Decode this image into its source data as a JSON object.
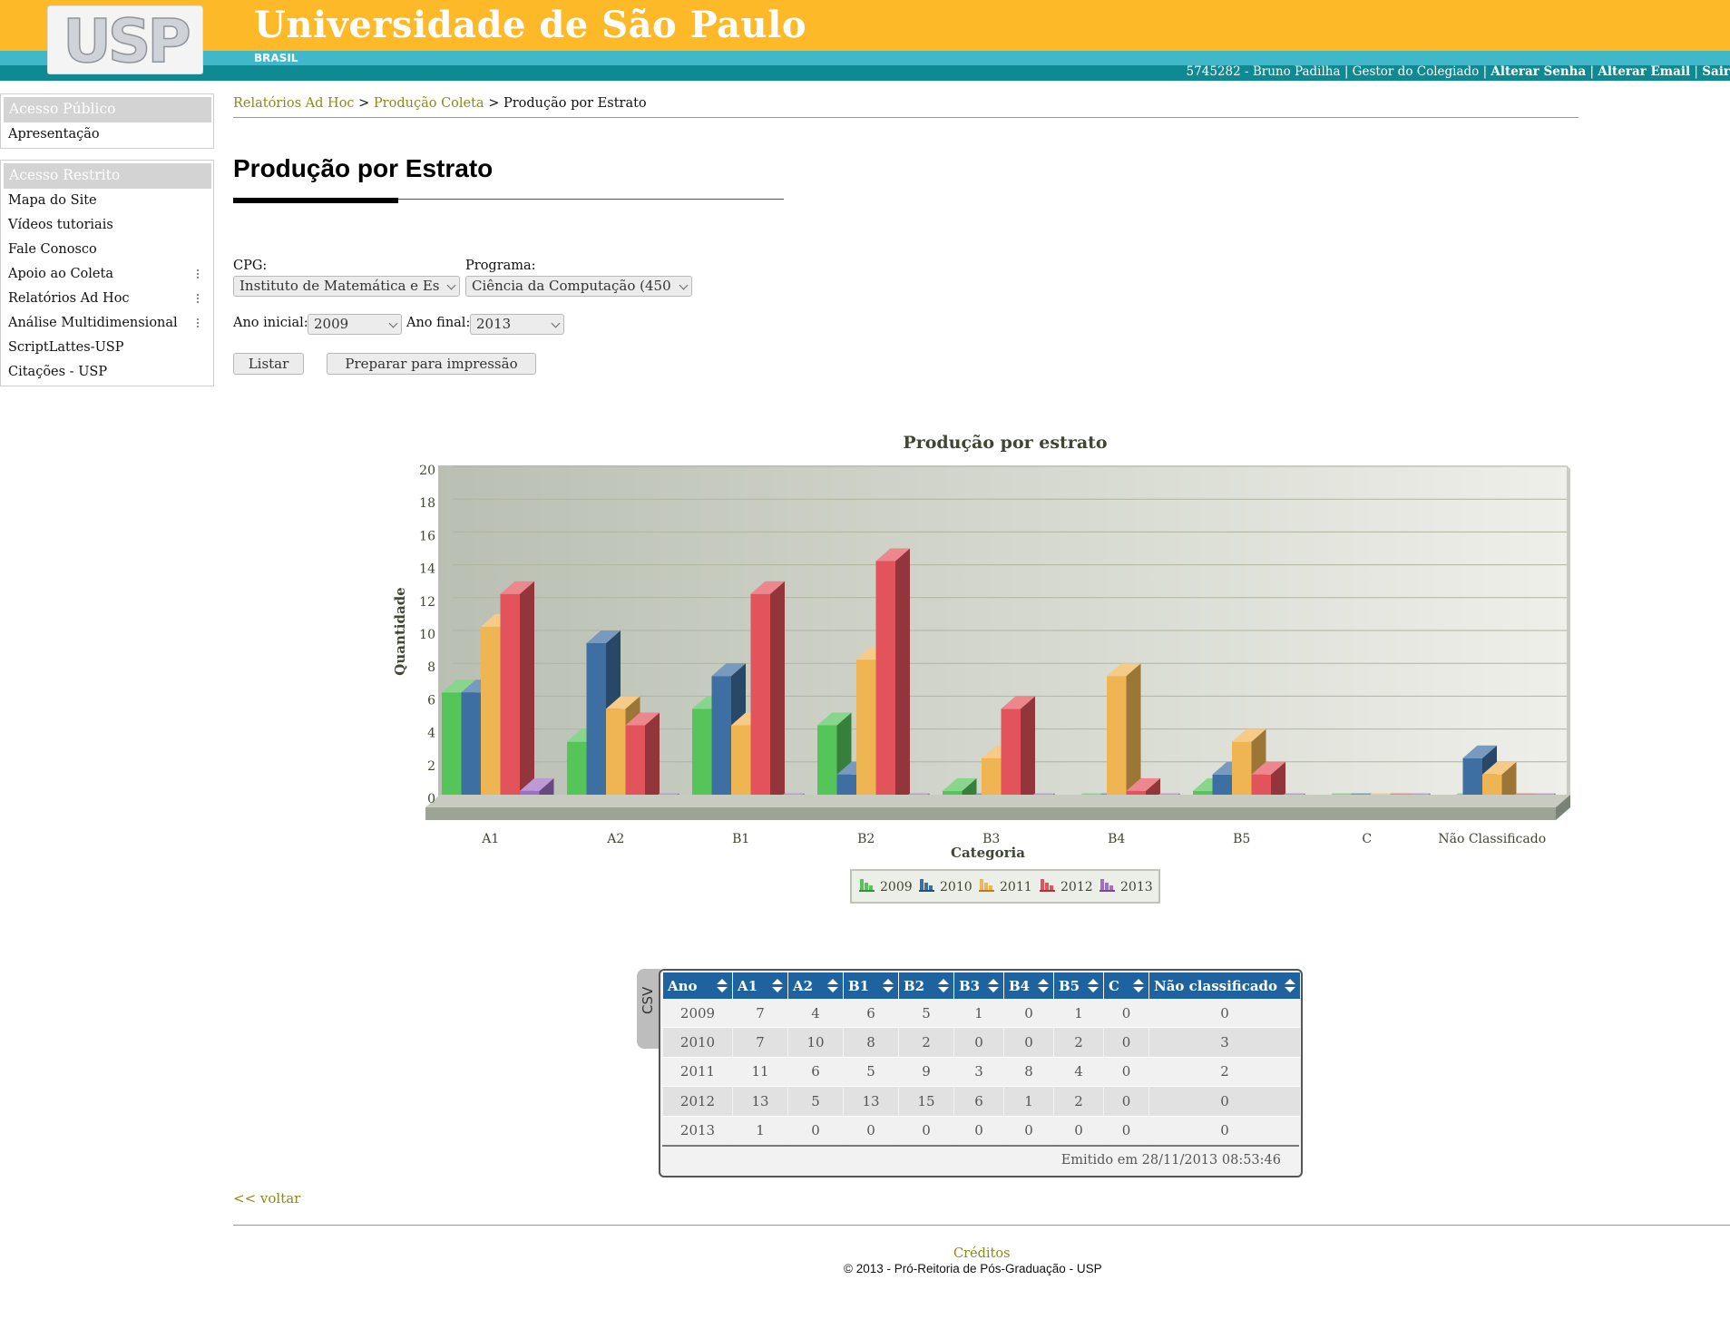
{
  "header": {
    "logo_text": "USP",
    "title": "Universidade de São Paulo",
    "country": "BRASIL",
    "user_info": "5745282 - Bruno Padilha | Gestor do Colegiado |",
    "change_password": "Alterar Senha",
    "change_email": "Alterar Email",
    "logout": "Sair",
    "sep": "|",
    "colors": {
      "top": "#fdb927",
      "stripe": "#41b8c9",
      "bar": "#0f8a93"
    }
  },
  "sidebar": {
    "public": {
      "title": "Acesso Público",
      "items": [
        "Apresentação"
      ]
    },
    "restricted": {
      "title": "Acesso Restrito",
      "items": [
        {
          "label": "Mapa do Site",
          "submenu": false
        },
        {
          "label": "Vídeos tutoriais",
          "submenu": false
        },
        {
          "label": "Fale Conosco",
          "submenu": false
        },
        {
          "label": "Apoio ao Coleta",
          "submenu": true
        },
        {
          "label": "Relatórios Ad Hoc",
          "submenu": true
        },
        {
          "label": "Análise Multidimensional",
          "submenu": true
        },
        {
          "label": "ScriptLattes-USP",
          "submenu": false
        },
        {
          "label": "Citações - USP",
          "submenu": false
        }
      ]
    }
  },
  "breadcrumb": {
    "items": [
      "Relatórios Ad Hoc",
      "Produção Coleta"
    ],
    "current": "Produção por Estrato",
    "sep": ">"
  },
  "page": {
    "title": "Produção por Estrato"
  },
  "form": {
    "cpg_label": "CPG:",
    "cpg_value": "Instituto de Matemática e Es",
    "program_label": "Programa:",
    "program_value": "Ciência da Computação (450",
    "start_label": "Ano inicial:",
    "start_value": "2009",
    "end_label": "Ano final:",
    "end_value": "2013",
    "list_button": "Listar",
    "print_button": "Preparar para impressão"
  },
  "chart_data": {
    "type": "bar",
    "title": "Produção por estrato",
    "xlabel": "Categoria",
    "ylabel": "Quantidade",
    "ylim": [
      0,
      20
    ],
    "yticks": [
      0,
      2,
      4,
      6,
      8,
      10,
      12,
      14,
      16,
      18,
      20
    ],
    "grid": true,
    "legend_position": "bottom",
    "categories": [
      "A1",
      "A2",
      "B1",
      "B2",
      "B3",
      "B4",
      "B5",
      "C",
      "Não Classificado"
    ],
    "series": [
      {
        "name": "2009",
        "color": "#55c55a",
        "values": [
          7,
          4,
          6,
          5,
          1,
          0,
          1,
          0,
          0
        ]
      },
      {
        "name": "2010",
        "color": "#3d6fa2",
        "values": [
          7,
          10,
          8,
          2,
          0,
          0,
          2,
          0,
          3
        ]
      },
      {
        "name": "2011",
        "color": "#f0b553",
        "values": [
          11,
          6,
          5,
          9,
          3,
          8,
          4,
          0,
          2
        ]
      },
      {
        "name": "2012",
        "color": "#e2535c",
        "values": [
          13,
          5,
          13,
          15,
          6,
          1,
          2,
          0,
          0
        ]
      },
      {
        "name": "2013",
        "color": "#a06ec5",
        "values": [
          1,
          0,
          0,
          0,
          0,
          0,
          0,
          0,
          0
        ]
      }
    ]
  },
  "table": {
    "side_tab": "CSV",
    "headers": [
      "Ano",
      "A1",
      "A2",
      "B1",
      "B2",
      "B3",
      "B4",
      "B5",
      "C",
      "Não classificado"
    ],
    "rows": [
      [
        "2009",
        "7",
        "4",
        "6",
        "5",
        "1",
        "0",
        "1",
        "0",
        "0"
      ],
      [
        "2010",
        "7",
        "10",
        "8",
        "2",
        "0",
        "0",
        "2",
        "0",
        "3"
      ],
      [
        "2011",
        "11",
        "6",
        "5",
        "9",
        "3",
        "8",
        "4",
        "0",
        "2"
      ],
      [
        "2012",
        "13",
        "5",
        "13",
        "15",
        "6",
        "1",
        "2",
        "0",
        "0"
      ],
      [
        "2013",
        "1",
        "0",
        "0",
        "0",
        "0",
        "0",
        "0",
        "0",
        "0"
      ]
    ],
    "issued": "Emitido em 28/11/2013 08:53:46"
  },
  "footer": {
    "back": "<<  voltar",
    "credits": "Créditos",
    "copyright": "© 2013 - Pró-Reitoria de Pós-Graduação - USP"
  }
}
